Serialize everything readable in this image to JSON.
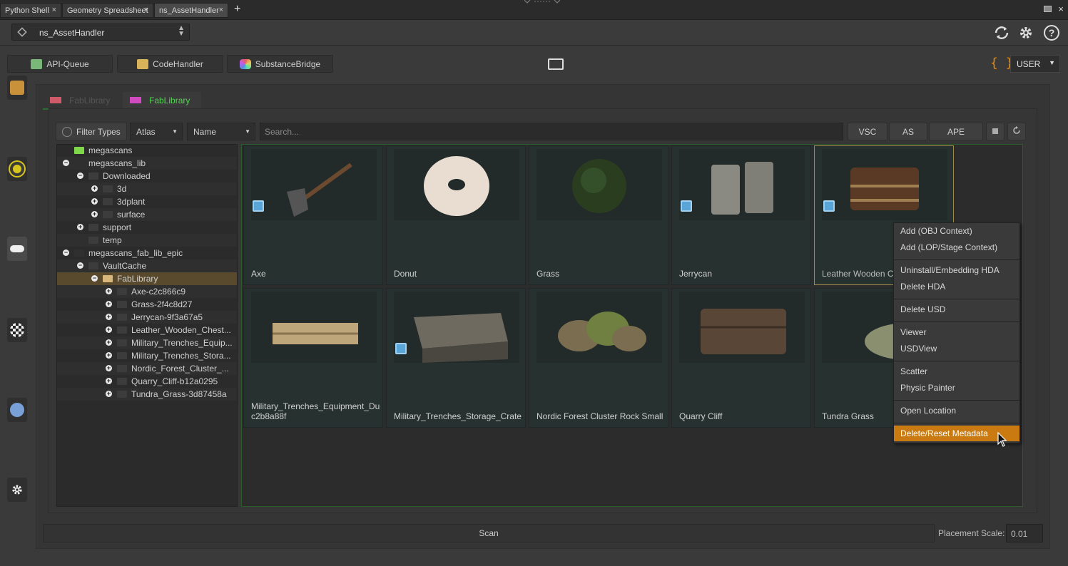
{
  "tabs": [
    {
      "label": "Python Shell",
      "active": false
    },
    {
      "label": "Geometry Spreadsheet",
      "active": false
    },
    {
      "label": "ns_AssetHandler",
      "active": true
    }
  ],
  "tab_add": "+",
  "pane_close": "×",
  "close_glyph": "×",
  "path_combo": {
    "value": "ns_AssetHandler"
  },
  "header_buttons": [
    {
      "label": "API-Queue"
    },
    {
      "label": "CodeHandler"
    },
    {
      "label": "SubstanceBridge"
    }
  ],
  "braces_label": "{ }",
  "user_dropdown": "USER",
  "panel_tabs": [
    {
      "label": "FabLibrary",
      "active": false,
      "color": "#d05a6a"
    },
    {
      "label": "FabLibrary",
      "active": true,
      "color": "#d04ac0"
    }
  ],
  "filter": {
    "filter_types": "Filter Types",
    "atlas": "Atlas",
    "name": "Name",
    "search_placeholder": "Search...",
    "vsc": "VSC",
    "as": "AS",
    "ape": "APE"
  },
  "tree": [
    {
      "label": "megascans",
      "depth": 1,
      "toggle": "",
      "icon": "folder-green"
    },
    {
      "label": "megascans_lib",
      "depth": 1,
      "toggle": "−",
      "icon": "lib"
    },
    {
      "label": "Downloaded",
      "depth": 2,
      "toggle": "−",
      "icon": "folder"
    },
    {
      "label": "3d",
      "depth": 3,
      "toggle": "+",
      "icon": "folder"
    },
    {
      "label": "3dplant",
      "depth": 3,
      "toggle": "+",
      "icon": "folder"
    },
    {
      "label": "surface",
      "depth": 3,
      "toggle": "+",
      "icon": "folder"
    },
    {
      "label": "support",
      "depth": 2,
      "toggle": "+",
      "icon": "folder"
    },
    {
      "label": "temp",
      "depth": 2,
      "toggle": "",
      "icon": "folder"
    },
    {
      "label": "megascans_fab_lib_epic",
      "depth": 1,
      "toggle": "−",
      "icon": "lib"
    },
    {
      "label": "VaultCache",
      "depth": 2,
      "toggle": "−",
      "icon": "folder"
    },
    {
      "label": "FabLibrary",
      "depth": 3,
      "toggle": "−",
      "icon": "folder-open",
      "selected": true
    },
    {
      "label": "Axe-c2c866c9",
      "depth": 4,
      "toggle": "+",
      "icon": "folder"
    },
    {
      "label": "Grass-2f4c8d27",
      "depth": 4,
      "toggle": "+",
      "icon": "folder"
    },
    {
      "label": "Jerrycan-9f3a67a5",
      "depth": 4,
      "toggle": "+",
      "icon": "folder"
    },
    {
      "label": "Leather_Wooden_Chest...",
      "depth": 4,
      "toggle": "+",
      "icon": "folder"
    },
    {
      "label": "Military_Trenches_Equip...",
      "depth": 4,
      "toggle": "+",
      "icon": "folder"
    },
    {
      "label": "Military_Trenches_Stora...",
      "depth": 4,
      "toggle": "+",
      "icon": "folder"
    },
    {
      "label": "Nordic_Forest_Cluster_...",
      "depth": 4,
      "toggle": "+",
      "icon": "folder"
    },
    {
      "label": "Quarry_Cliff-b12a0295",
      "depth": 4,
      "toggle": "+",
      "icon": "folder"
    },
    {
      "label": "Tundra_Grass-3d87458a",
      "depth": 4,
      "toggle": "+",
      "icon": "folder"
    }
  ],
  "assets": [
    {
      "name": "Axe",
      "badge": true,
      "thumb": "axe"
    },
    {
      "name": "Donut",
      "badge": false,
      "thumb": "donut"
    },
    {
      "name": "Grass",
      "badge": false,
      "thumb": "grass"
    },
    {
      "name": "Jerrycan",
      "badge": true,
      "thumb": "jerrycan"
    },
    {
      "name": "Leather Wooden Ch",
      "badge": true,
      "thumb": "chest",
      "highlight": true
    },
    {
      "name": "Military_Trenches_Equipment_Du c2b8a88f",
      "badge": false,
      "thumb": "equipment"
    },
    {
      "name": "Military_Trenches_Storage_Crate",
      "badge": true,
      "thumb": "crate"
    },
    {
      "name": "Nordic Forest Cluster Rock Small",
      "badge": false,
      "thumb": "rock"
    },
    {
      "name": "Quarry Cliff",
      "badge": false,
      "thumb": "cliff"
    },
    {
      "name": "Tundra Grass",
      "badge": false,
      "thumb": "tundra"
    }
  ],
  "context_menu": {
    "items": [
      {
        "label": "Add (OBJ Context)",
        "group": 0
      },
      {
        "label": "Add (LOP/Stage Context)",
        "group": 0
      },
      {
        "label": "Uninstall/Embedding HDA",
        "group": 1
      },
      {
        "label": "Delete HDA",
        "group": 1
      },
      {
        "label": "Delete USD",
        "group": 2
      },
      {
        "label": "Viewer",
        "group": 3
      },
      {
        "label": "USDView",
        "group": 3
      },
      {
        "label": "Scatter",
        "group": 4
      },
      {
        "label": "Physic Painter",
        "group": 4
      },
      {
        "label": "Open Location",
        "group": 5
      },
      {
        "label": "Delete/Reset Metadata",
        "group": 6,
        "active": true
      }
    ]
  },
  "bottom": {
    "scan": "Scan",
    "placement_label": "Placement Scale:",
    "placement_value": "0.01"
  },
  "colors": {
    "accent_orange": "#c97a10",
    "active_tab_text": "#52d452",
    "braces": "#e08a1a"
  }
}
